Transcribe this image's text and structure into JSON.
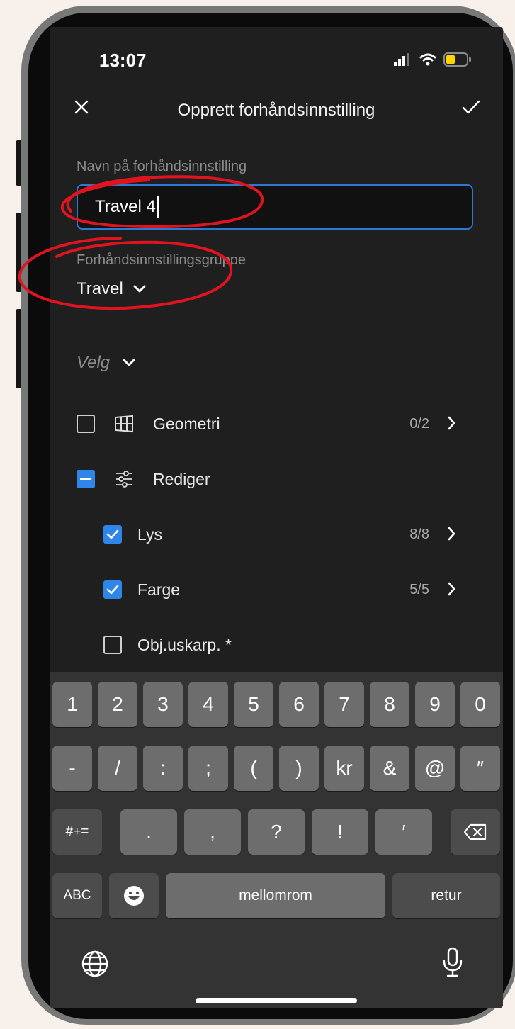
{
  "status_bar": {
    "time": "13:07"
  },
  "header": {
    "title": "Opprett forhåndsinnstilling"
  },
  "form": {
    "name_label": "Navn på forhåndsinnstilling",
    "name_value": "Travel 4",
    "group_label": "Forhåndsinnstillingsgruppe",
    "group_value": "Travel",
    "select_label": "Velg"
  },
  "settings": [
    {
      "label": "Geometri",
      "count": "0/2",
      "checked": "off",
      "icon": "geometry-icon"
    },
    {
      "label": "Rediger",
      "count": "",
      "checked": "partial",
      "icon": "sliders-icon"
    },
    {
      "label": "Lys",
      "count": "8/8",
      "checked": "on"
    },
    {
      "label": "Farge",
      "count": "5/5",
      "checked": "on"
    },
    {
      "label": "Obj.uskarp. *",
      "count": "",
      "checked": "off"
    }
  ],
  "keyboard": {
    "row1": [
      "1",
      "2",
      "3",
      "4",
      "5",
      "6",
      "7",
      "8",
      "9",
      "0"
    ],
    "row2": [
      "-",
      "/",
      ":",
      ";",
      "(",
      ")",
      "kr",
      "&",
      "@",
      "″"
    ],
    "row3": [
      "#+=",
      ".",
      ",",
      "?",
      "!",
      "′"
    ],
    "abc": "ABC",
    "space": "mellomrom",
    "return": "retur"
  },
  "colors": {
    "accent": "#2f86e8",
    "annotation": "#e0141e",
    "background": "#1f1f1f"
  }
}
